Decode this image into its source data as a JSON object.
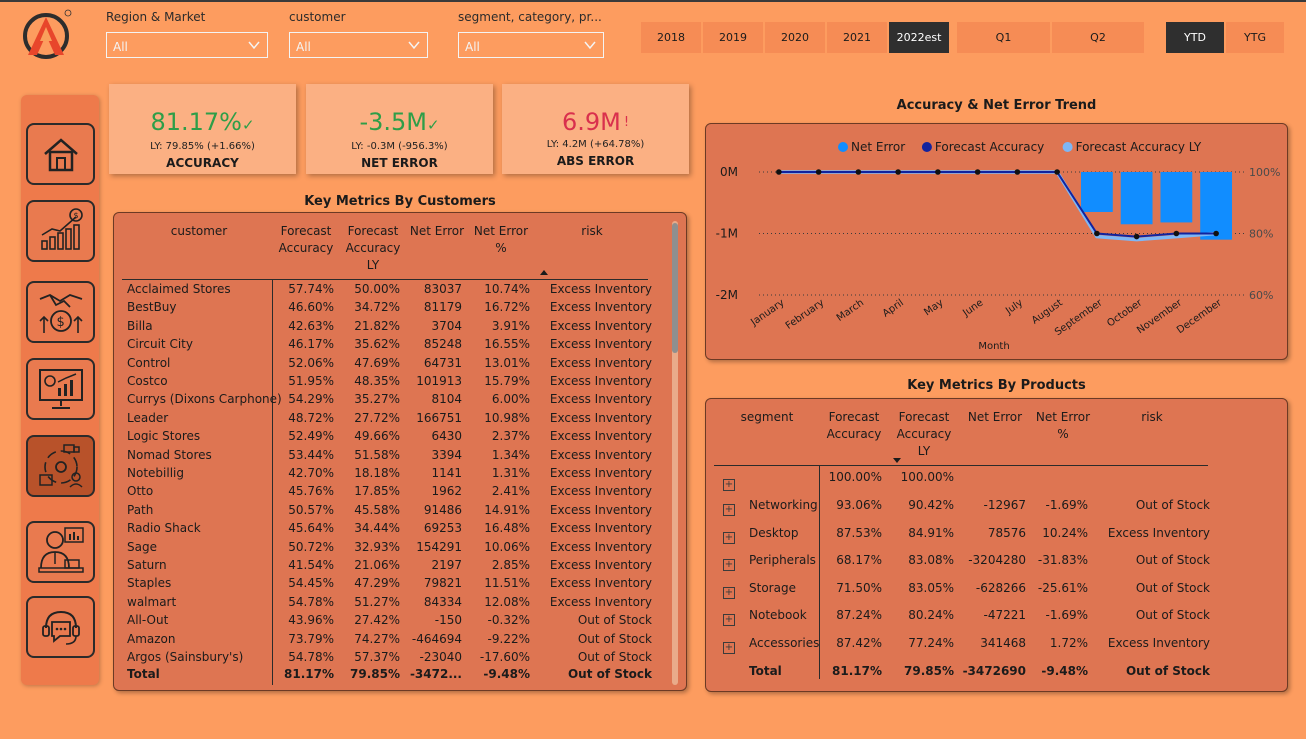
{
  "filters": [
    {
      "label": "Region & Market",
      "value": "All"
    },
    {
      "label": "customer",
      "value": "All"
    },
    {
      "label": "segment, category, pr...",
      "value": "All"
    }
  ],
  "years": [
    "2018",
    "2019",
    "2020",
    "2021",
    "2022est"
  ],
  "active_year": "2022est",
  "quarters": [
    "Q1",
    "Q2"
  ],
  "periods": [
    "YTD",
    "YTG"
  ],
  "active_period": "YTD",
  "kpis": [
    {
      "value": "81.17%",
      "mark": "✓",
      "ly": "LY: 79.85% (+1.66%)",
      "caption": "ACCURACY",
      "color": "#2E9E48"
    },
    {
      "value": "-3.5M",
      "mark": "✓",
      "ly": "LY: -0.3M (-956.3%)",
      "caption": "NET ERROR",
      "color": "#2E9E48"
    },
    {
      "value": "6.9M",
      "mark": "!",
      "ly": "LY: 4.2M (+64.78%)",
      "caption": "ABS ERROR",
      "color": "#D9304D"
    }
  ],
  "nav": [
    "home-icon",
    "sales-growth-icon",
    "finance-handshake-icon",
    "analytics-monitor-icon",
    "supply-chain-icon",
    "executive-icon",
    "support-chat-icon"
  ],
  "customers_table": {
    "title": "Key Metrics By Customers",
    "headers": {
      "customer": "customer",
      "fa": "Forecast Accuracy",
      "fa_ly": "Forecast Accuracy LY",
      "ne": "Net Error",
      "ne_pct": "Net Error %",
      "risk": "risk"
    },
    "rows": [
      [
        "Acclaimed Stores",
        "57.74%",
        "50.00%",
        "83037",
        "10.74%",
        "Excess Inventory"
      ],
      [
        "BestBuy",
        "46.60%",
        "34.72%",
        "81179",
        "16.72%",
        "Excess Inventory"
      ],
      [
        "Billa",
        "42.63%",
        "21.82%",
        "3704",
        "3.91%",
        "Excess Inventory"
      ],
      [
        "Circuit City",
        "46.17%",
        "35.62%",
        "85248",
        "16.55%",
        "Excess Inventory"
      ],
      [
        "Control",
        "52.06%",
        "47.69%",
        "64731",
        "13.01%",
        "Excess Inventory"
      ],
      [
        "Costco",
        "51.95%",
        "48.35%",
        "101913",
        "15.79%",
        "Excess Inventory"
      ],
      [
        "Currys (Dixons Carphone)",
        "54.29%",
        "35.27%",
        "8104",
        "6.00%",
        "Excess Inventory"
      ],
      [
        "Leader",
        "48.72%",
        "27.72%",
        "166751",
        "10.98%",
        "Excess Inventory"
      ],
      [
        "Logic Stores",
        "52.49%",
        "49.66%",
        "6430",
        "2.37%",
        "Excess Inventory"
      ],
      [
        "Nomad Stores",
        "53.44%",
        "51.58%",
        "3394",
        "1.34%",
        "Excess Inventory"
      ],
      [
        "Notebillig",
        "42.70%",
        "18.18%",
        "1141",
        "1.31%",
        "Excess Inventory"
      ],
      [
        "Otto",
        "45.76%",
        "17.85%",
        "1962",
        "2.41%",
        "Excess Inventory"
      ],
      [
        "Path",
        "50.57%",
        "45.58%",
        "91486",
        "14.91%",
        "Excess Inventory"
      ],
      [
        "Radio Shack",
        "45.64%",
        "34.44%",
        "69253",
        "16.48%",
        "Excess Inventory"
      ],
      [
        "Sage",
        "50.72%",
        "32.93%",
        "154291",
        "10.06%",
        "Excess Inventory"
      ],
      [
        "Saturn",
        "41.54%",
        "21.06%",
        "2197",
        "2.85%",
        "Excess Inventory"
      ],
      [
        "Staples",
        "54.45%",
        "47.29%",
        "79821",
        "11.51%",
        "Excess Inventory"
      ],
      [
        "walmart",
        "54.78%",
        "51.27%",
        "84334",
        "12.08%",
        "Excess Inventory"
      ],
      [
        "All-Out",
        "43.96%",
        "27.42%",
        "-150",
        "-0.32%",
        "Out of Stock"
      ],
      [
        "Amazon",
        "73.79%",
        "74.27%",
        "-464694",
        "-9.22%",
        "Out of Stock"
      ],
      [
        "Argos (Sainsbury's)",
        "54.78%",
        "57.37%",
        "-23040",
        "-17.60%",
        "Out of Stock"
      ]
    ],
    "total": [
      "Total",
      "81.17%",
      "79.85%",
      "-3472...",
      "-9.48%",
      "Out of Stock"
    ]
  },
  "products_table": {
    "title": "Key Metrics By Products",
    "headers": {
      "segment": "segment",
      "fa": "Forecast Accuracy",
      "fa_ly": "Forecast Accuracy LY",
      "ne": "Net Error",
      "ne_pct": "Net Error %",
      "risk": "risk"
    },
    "rows": [
      [
        "",
        "100.00%",
        "100.00%",
        "",
        "",
        ""
      ],
      [
        "Networking",
        "93.06%",
        "90.42%",
        "-12967",
        "-1.69%",
        "Out of Stock"
      ],
      [
        "Desktop",
        "87.53%",
        "84.91%",
        "78576",
        "10.24%",
        "Excess Inventory"
      ],
      [
        "Peripherals",
        "68.17%",
        "83.08%",
        "-3204280",
        "-31.83%",
        "Out of Stock"
      ],
      [
        "Storage",
        "71.50%",
        "83.05%",
        "-628266",
        "-25.61%",
        "Out of Stock"
      ],
      [
        "Notebook",
        "87.24%",
        "80.24%",
        "-47221",
        "-1.69%",
        "Out of Stock"
      ],
      [
        "Accessories",
        "87.42%",
        "77.24%",
        "341468",
        "1.72%",
        "Excess Inventory"
      ]
    ],
    "total": [
      "Total",
      "81.17%",
      "79.85%",
      "-3472690",
      "-9.48%",
      "Out of Stock"
    ]
  },
  "chart_data": {
    "type": "bar",
    "title": "Accuracy & Net Error Trend",
    "xlabel": "Month",
    "categories": [
      "January",
      "February",
      "March",
      "April",
      "May",
      "June",
      "July",
      "August",
      "September",
      "October",
      "November",
      "December"
    ],
    "y_left_ticks": [
      "0M",
      "-1M",
      "-2M"
    ],
    "y_left_range": [
      -2,
      0
    ],
    "y_right_ticks": [
      "100%",
      "80%",
      "60%"
    ],
    "y_right_range": [
      60,
      100
    ],
    "legend_position": "top",
    "series": [
      {
        "name": "Net Error",
        "kind": "bar",
        "axis": "left",
        "color": "#118DFF",
        "values": [
          0,
          0,
          0,
          0,
          0,
          0,
          0,
          0,
          -0.65,
          -0.85,
          -0.82,
          -1.1
        ]
      },
      {
        "name": "Forecast Accuracy",
        "kind": "line",
        "axis": "right",
        "color": "#12239E",
        "values": [
          100,
          100,
          100,
          100,
          100,
          100,
          100,
          100,
          80,
          79,
          80,
          80
        ]
      },
      {
        "name": "Forecast Accuracy LY",
        "kind": "line",
        "axis": "right",
        "color": "#7EB7F5",
        "values": [
          100,
          100,
          100,
          100,
          100,
          100,
          100,
          100,
          79,
          78,
          79,
          80
        ]
      }
    ]
  }
}
